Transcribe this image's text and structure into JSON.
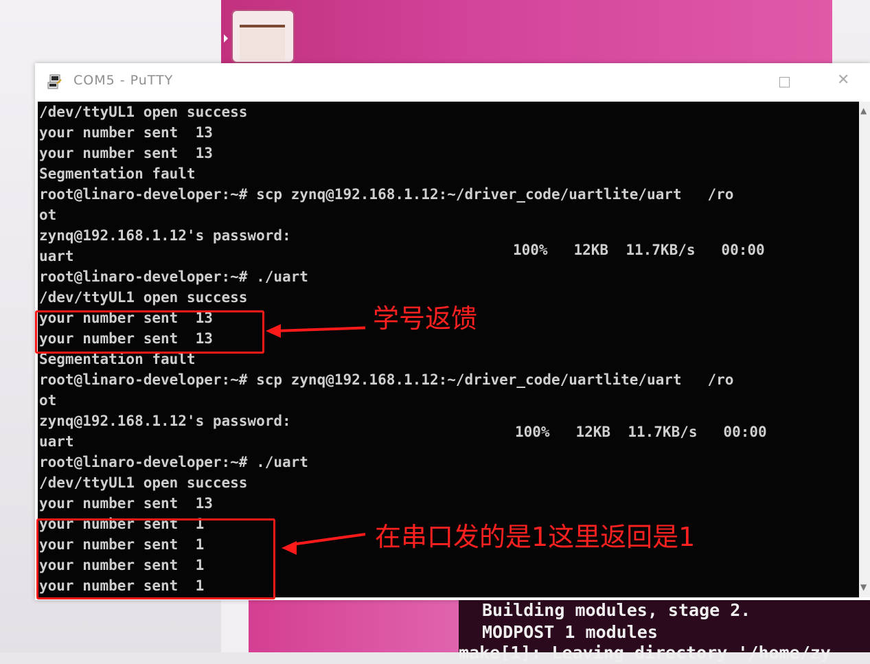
{
  "window": {
    "title": "COM5 - PuTTY",
    "maximize_glyph": "□",
    "close_glyph": "✕"
  },
  "terminal": {
    "lines": [
      "/dev/ttyUL1 open success",
      "your number sent  13",
      "your number sent  13",
      "Segmentation fault",
      "root@linaro-developer:~# scp zynq@192.168.1.12:~/driver_code/uartlite/uart   /ro",
      "ot",
      "zynq@192.168.1.12's password:",
      "uart",
      "root@linaro-developer:~# ./uart",
      "/dev/ttyUL1 open success",
      "your number sent  13",
      "your number sent  13",
      "Segmentation fault",
      "root@linaro-developer:~# scp zynq@192.168.1.12:~/driver_code/uartlite/uart   /ro",
      "ot",
      "zynq@192.168.1.12's password:",
      "uart",
      "root@linaro-developer:~# ./uart",
      "/dev/ttyUL1 open success",
      "your number sent  13",
      "your number sent  1",
      "your number sent  1",
      "your number sent  1",
      "your number sent  1"
    ],
    "transfer_1": "100%   12KB  11.7KB/s   00:00",
    "transfer_2": "100%   12KB  11.7KB/s   00:00"
  },
  "annotations": {
    "label_1": "学号返馈",
    "label_2": "在串口发的是1这里返回是1",
    "color": "#ff1a1a"
  },
  "background_terminal": {
    "lines": [
      "Building modules, stage 2.",
      "MODPOST 1 modules",
      "make[1]: Leaving directory '/home/zy"
    ]
  }
}
